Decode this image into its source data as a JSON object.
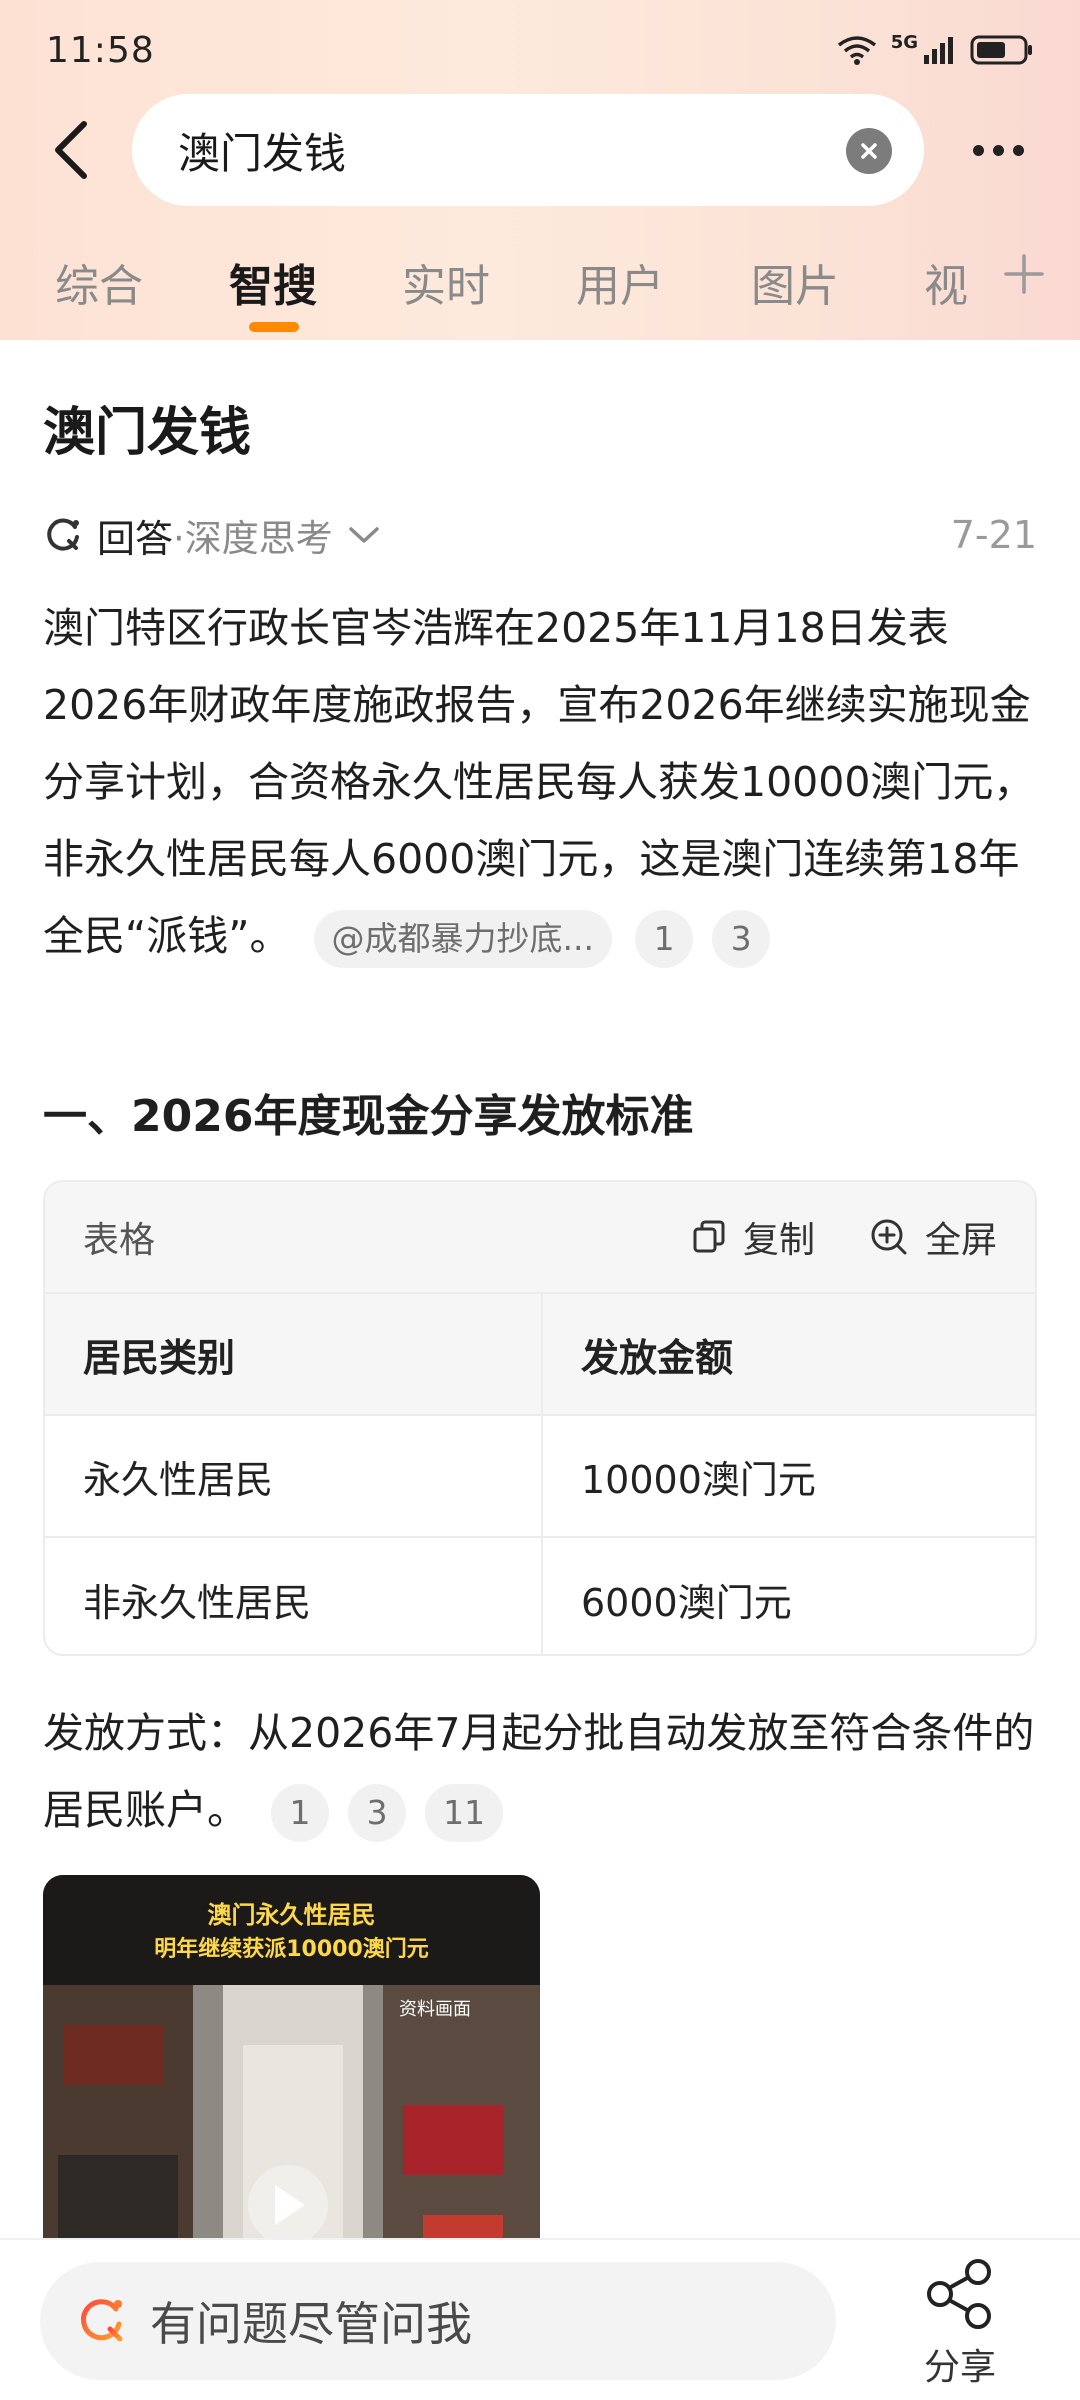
{
  "status_bar": {
    "time": "11:58",
    "network": "5G",
    "icons": [
      "wifi-icon",
      "signal-icon",
      "battery-icon"
    ]
  },
  "search": {
    "query": "澳门发钱",
    "back_icon": "chevron-left-icon",
    "clear_icon": "close-circle-icon",
    "more_icon": "more-dots-icon"
  },
  "tabs": [
    {
      "label": "综合",
      "active": false
    },
    {
      "label": "智搜",
      "active": true
    },
    {
      "label": "实时",
      "active": false
    },
    {
      "label": "用户",
      "active": false
    },
    {
      "label": "图片",
      "active": false
    },
    {
      "label": "视",
      "active": false
    }
  ],
  "main": {
    "title": "澳门发钱",
    "answer": {
      "label": "回答",
      "sub": "·深度思考",
      "date": "7-21"
    },
    "paragraph1": "澳门特区行政长官岑浩辉在2025年11月18日发表2026年财政年度施政报告，宣布2026年继续实施现金分享计划，合资格永久性居民每人获发10000澳门元，非永久性居民每人6000澳门元，这是澳门连续第18年全民“派钱”。",
    "paragraph1_source": "@成都暴力抄底...",
    "paragraph1_refs": [
      "1",
      "3"
    ],
    "section_title": "一、2026年度现金分享发放标准",
    "table": {
      "label": "表格",
      "copy_label": "复制",
      "fullscreen_label": "全屏",
      "columns": [
        "居民类别",
        "发放金额"
      ],
      "rows": [
        [
          "永久性居民",
          "10000澳门元"
        ],
        [
          "非永久性居民",
          "6000澳门元"
        ]
      ]
    },
    "paragraph2": "发放方式：从2026年7月起分批自动发放至符合条件的居民账户。",
    "paragraph2_refs": [
      "1",
      "3",
      "11"
    ],
    "video": {
      "caption_line1": "澳门永久性居民",
      "caption_line2": "明年继续获派10000澳门元",
      "watermark": "资料画面",
      "play_icon": "play-icon"
    }
  },
  "bottom_bar": {
    "ask_placeholder": "有问题尽管问我",
    "share_label": "分享"
  },
  "colors": {
    "accent": "#ff8a00",
    "header_gradient_start": "#fde2d4",
    "header_gradient_end": "#fad9d2"
  }
}
